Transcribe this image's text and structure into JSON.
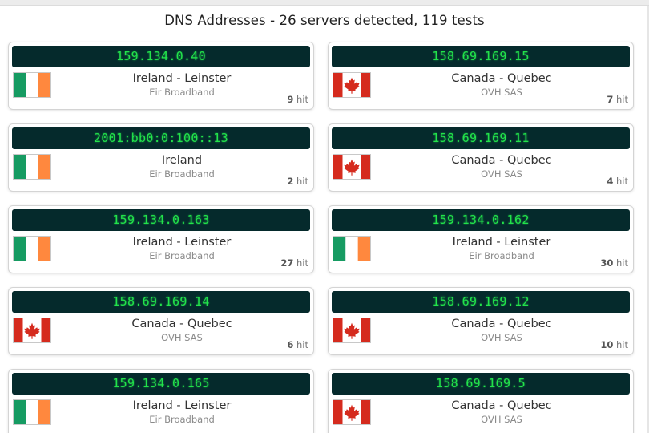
{
  "heading": "DNS Addresses - 26 servers detected, 119 tests",
  "hit_suffix": "hit",
  "colors": {
    "ip_bar_background": "#052a2c",
    "ip_text": "#22e34a"
  },
  "servers": [
    {
      "ip": "159.134.0.40",
      "location": "Ireland - Leinster",
      "isp": "Eir Broadband",
      "hits": "9",
      "flag": "ireland-flag-icon"
    },
    {
      "ip": "158.69.169.15",
      "location": "Canada - Quebec",
      "isp": "OVH SAS",
      "hits": "7",
      "flag": "canada-flag-icon"
    },
    {
      "ip": "2001:bb0:0:100::13",
      "location": "Ireland",
      "isp": "Eir Broadband",
      "hits": "2",
      "flag": "ireland-flag-icon"
    },
    {
      "ip": "158.69.169.11",
      "location": "Canada - Quebec",
      "isp": "OVH SAS",
      "hits": "4",
      "flag": "canada-flag-icon"
    },
    {
      "ip": "159.134.0.163",
      "location": "Ireland - Leinster",
      "isp": "Eir Broadband",
      "hits": "27",
      "flag": "ireland-flag-icon"
    },
    {
      "ip": "159.134.0.162",
      "location": "Ireland - Leinster",
      "isp": "Eir Broadband",
      "hits": "30",
      "flag": "ireland-flag-icon"
    },
    {
      "ip": "158.69.169.14",
      "location": "Canada - Quebec",
      "isp": "OVH SAS",
      "hits": "6",
      "flag": "canada-flag-icon"
    },
    {
      "ip": "158.69.169.12",
      "location": "Canada - Quebec",
      "isp": "OVH SAS",
      "hits": "10",
      "flag": "canada-flag-icon"
    },
    {
      "ip": "159.134.0.165",
      "location": "Ireland - Leinster",
      "isp": "Eir Broadband",
      "hits": "",
      "flag": "ireland-flag-icon"
    },
    {
      "ip": "158.69.169.5",
      "location": "Canada - Quebec",
      "isp": "OVH SAS",
      "hits": "",
      "flag": "canada-flag-icon"
    }
  ]
}
